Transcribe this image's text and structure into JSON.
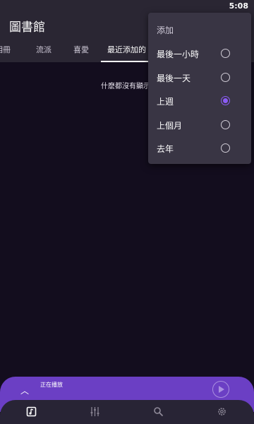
{
  "status_bar": {
    "time": "5:08"
  },
  "app_bar": {
    "title": "圖書館"
  },
  "tabs": [
    {
      "label": "相冊"
    },
    {
      "label": "流派"
    },
    {
      "label": "喜愛"
    },
    {
      "label": "最近添加的"
    }
  ],
  "main": {
    "empty_message": "什麽都沒有顯示"
  },
  "dropdown": {
    "header": "添加",
    "options": [
      {
        "label": "最後一小時",
        "checked": false
      },
      {
        "label": "最後一天",
        "checked": false
      },
      {
        "label": "上週",
        "checked": true
      },
      {
        "label": "上個月",
        "checked": false
      },
      {
        "label": "去年",
        "checked": false
      }
    ]
  },
  "now_playing": {
    "label": "正在播放"
  },
  "bottom_nav": {
    "items": [
      {
        "icon": "library-icon"
      },
      {
        "icon": "equalizer-icon"
      },
      {
        "icon": "search-icon"
      },
      {
        "icon": "settings-icon"
      }
    ]
  },
  "colors": {
    "accent": "#8b5cf6",
    "now_playing_bg": "#6b3fc4",
    "background": "#130d1e"
  }
}
